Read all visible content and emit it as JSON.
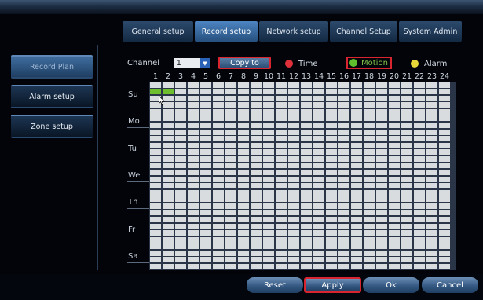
{
  "tabs": [
    {
      "label": "General setup",
      "active": false
    },
    {
      "label": "Record setup",
      "active": true
    },
    {
      "label": "Network setup",
      "active": false
    },
    {
      "label": "Channel Setup",
      "active": false
    },
    {
      "label": "System Admin",
      "active": false
    }
  ],
  "sidebar": {
    "items": [
      {
        "label": "Record Plan",
        "active": true
      },
      {
        "label": "Alarm setup",
        "active": false
      },
      {
        "label": "Zone setup",
        "active": false
      }
    ]
  },
  "channel": {
    "label": "Channel",
    "value": "1",
    "dropdown_icon": "triangle-down"
  },
  "copy_to": {
    "label": "Copy to"
  },
  "legend": {
    "time": {
      "label": "Time",
      "color": "#e0313a",
      "icon": "clock"
    },
    "motion": {
      "label": "Motion",
      "color": "#5fbf2d",
      "icon": "running-person"
    },
    "alarm": {
      "label": "Alarm",
      "color": "#e8d83a"
    }
  },
  "hours": [
    "1",
    "2",
    "3",
    "4",
    "5",
    "6",
    "7",
    "8",
    "9",
    "10",
    "11",
    "12",
    "13",
    "14",
    "15",
    "16",
    "17",
    "18",
    "19",
    "20",
    "21",
    "22",
    "23",
    "24"
  ],
  "days": [
    "Su",
    "Mo",
    "Tu",
    "We",
    "Th",
    "Fr",
    "Sa"
  ],
  "schedule": {
    "rows_per_day": 4,
    "enabled_color": "#6fbe2e",
    "enabled": [
      {
        "day": 0,
        "row": 1,
        "hour": 1
      },
      {
        "day": 0,
        "row": 1,
        "hour": 2
      }
    ]
  },
  "buttons": {
    "reset": "Reset",
    "apply": "Apply",
    "ok": "Ok",
    "cancel": "Cancel"
  }
}
